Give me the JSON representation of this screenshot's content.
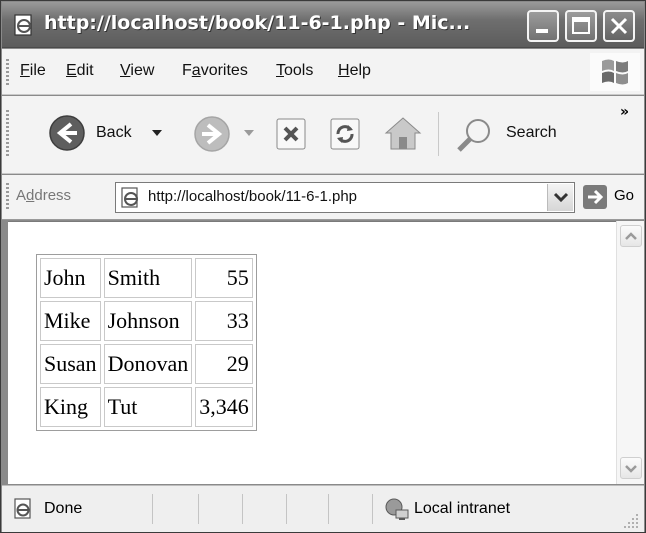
{
  "window": {
    "title": "http://localhost/book/11-6-1.php - Mic..."
  },
  "menu": [
    {
      "pre": "",
      "ul": "F",
      "post": "ile"
    },
    {
      "pre": "",
      "ul": "E",
      "post": "dit"
    },
    {
      "pre": "",
      "ul": "V",
      "post": "iew"
    },
    {
      "pre": "F",
      "ul": "a",
      "post": "vorites"
    },
    {
      "pre": "",
      "ul": "T",
      "post": "ools"
    },
    {
      "pre": "",
      "ul": "H",
      "post": "elp"
    }
  ],
  "toolbar": {
    "back_label": "Back",
    "search_label": "Search",
    "more_glyph": "»"
  },
  "address": {
    "label_pre": "A",
    "label_ul": "d",
    "label_post": "dress",
    "url": "http://localhost/book/11-6-1.php",
    "go_label": "Go"
  },
  "table": {
    "rows": [
      [
        "John",
        "Smith",
        "55"
      ],
      [
        "Mike",
        "Johnson",
        "33"
      ],
      [
        "Susan",
        "Donovan",
        "29"
      ],
      [
        "King",
        "Tut",
        "3,346"
      ]
    ]
  },
  "status": {
    "text": "Done",
    "zone": "Local intranet"
  },
  "colors": {
    "titlebar": "#6e6e6e",
    "chrome": "#f3f3f3"
  }
}
